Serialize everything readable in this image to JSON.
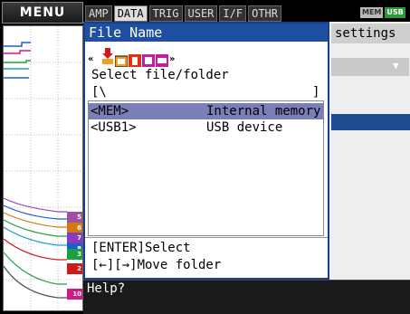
{
  "menu_label": "MENU",
  "tabs": [
    {
      "label": "AMP",
      "active": false
    },
    {
      "label": "DATA",
      "active": true
    },
    {
      "label": "TRIG",
      "active": false
    },
    {
      "label": "USER",
      "active": false
    },
    {
      "label": "I/F",
      "active": false
    },
    {
      "label": "OTHR",
      "active": false
    }
  ],
  "badges": [
    "MEM",
    "USB"
  ],
  "background_panel": {
    "header": "settings"
  },
  "dialog": {
    "title": "File Name",
    "prompt": "Select file/folder",
    "path_open": "[\\",
    "path_close": "]",
    "items": [
      {
        "name": "<MEM>",
        "description": "Internal memory",
        "selected": true
      },
      {
        "name": "<USB1>",
        "description": "USB device",
        "selected": false
      }
    ],
    "hint_select": "[ENTER]Select",
    "hint_move": "[←][→]Move folder"
  },
  "nav_icons": [
    "prev-arrow-icon",
    "folder-up-icon",
    "folder-icon",
    "delete-icon",
    "media-icon",
    "next-arrow-icon"
  ],
  "channel_tags": [
    "5",
    "6",
    "7",
    "8",
    "3",
    "2",
    "10"
  ],
  "help_text": "Help?",
  "colors": {
    "dialog_title_bg": "#1f4fa0",
    "selection_bg": "#7a7fb8",
    "tab_active_bg": "#dddddd"
  }
}
